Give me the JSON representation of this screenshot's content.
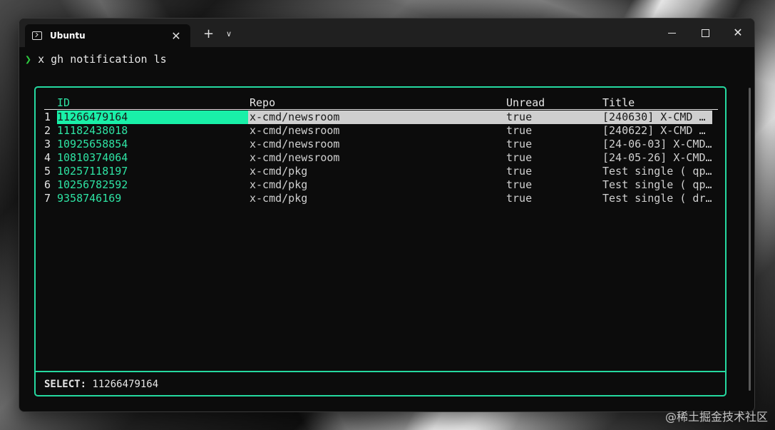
{
  "window": {
    "tab_title": "Ubuntu",
    "tab_close": "✕",
    "new_tab": "+",
    "dropdown": "∨",
    "close": "✕"
  },
  "terminal": {
    "prompt_arrow": "❯",
    "command": "x gh notification ls"
  },
  "table": {
    "headers": {
      "id": "ID",
      "repo": "Repo",
      "unread": "Unread",
      "title": "Title"
    },
    "rows": [
      {
        "num": "1",
        "id": "11266479164",
        "repo": "x-cmd/newsroom",
        "unread": "true",
        "title": "[240630] X-CMD …"
      },
      {
        "num": "2",
        "id": "11182438018",
        "repo": "x-cmd/newsroom",
        "unread": "true",
        "title": "[240622] X-CMD …"
      },
      {
        "num": "3",
        "id": "10925658854",
        "repo": "x-cmd/newsroom",
        "unread": "true",
        "title": "[24-06-03] X-CMD…"
      },
      {
        "num": "4",
        "id": "10810374064",
        "repo": "x-cmd/newsroom",
        "unread": "true",
        "title": "[24-05-26] X-CMD…"
      },
      {
        "num": "5",
        "id": "10257118197",
        "repo": "x-cmd/pkg",
        "unread": "true",
        "title": "Test single ( qp…"
      },
      {
        "num": "6",
        "id": "10256782592",
        "repo": "x-cmd/pkg",
        "unread": "true",
        "title": "Test single ( qp…"
      },
      {
        "num": "7",
        "id": "9358746169",
        "repo": "x-cmd/pkg",
        "unread": "true",
        "title": "Test single ( dr…"
      }
    ],
    "selected_index": 0
  },
  "footer": {
    "label": "SELECT:",
    "value": "11266479164"
  },
  "watermark": "@稀土掘金技术社区",
  "colors": {
    "accent": "#25d9a0",
    "selection_id": "#19f0a8",
    "selection_row": "#cfcfcf",
    "id_text": "#2ee3a3",
    "prompt_arrow": "#2ecc40",
    "background": "#0c0c0c"
  }
}
